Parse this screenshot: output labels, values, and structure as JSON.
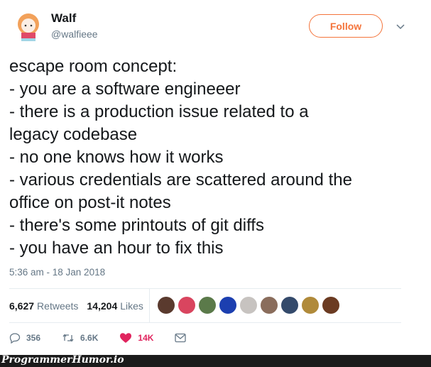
{
  "user": {
    "name": "Walf",
    "handle": "@walfieee"
  },
  "follow_label": "Follow",
  "tweet_lines": [
    "escape room concept:",
    "- you are a software engineeer",
    "- there is a production issue related to a",
    "legacy codebase",
    "- no one knows how it works",
    "- various credentials are scattered around the",
    "office on post-it notes",
    "- there's some printouts of git diffs",
    "- you have an hour to fix this"
  ],
  "timestamp": "5:36 am - 18 Jan 2018",
  "stats": {
    "retweets_count": "6,627",
    "retweets_label": "Retweets",
    "likes_count": "14,204",
    "likes_label": "Likes"
  },
  "liker_avatars": [
    {
      "color": "#5a3a2e"
    },
    {
      "color": "#d9455f"
    },
    {
      "color": "#5b7a4a"
    },
    {
      "color": "#1c3fb0"
    },
    {
      "color": "#c7c3c0"
    },
    {
      "color": "#8a6d5c"
    },
    {
      "color": "#344a6b"
    },
    {
      "color": "#b08a3a"
    },
    {
      "color": "#6b3b22"
    }
  ],
  "actions": {
    "replies": "356",
    "retweets": "6.6K",
    "likes": "14K"
  },
  "colors": {
    "accent": "#f4743b",
    "like": "#e0245e",
    "muted": "#657786"
  },
  "watermark": "ProgrammerHumor.io"
}
